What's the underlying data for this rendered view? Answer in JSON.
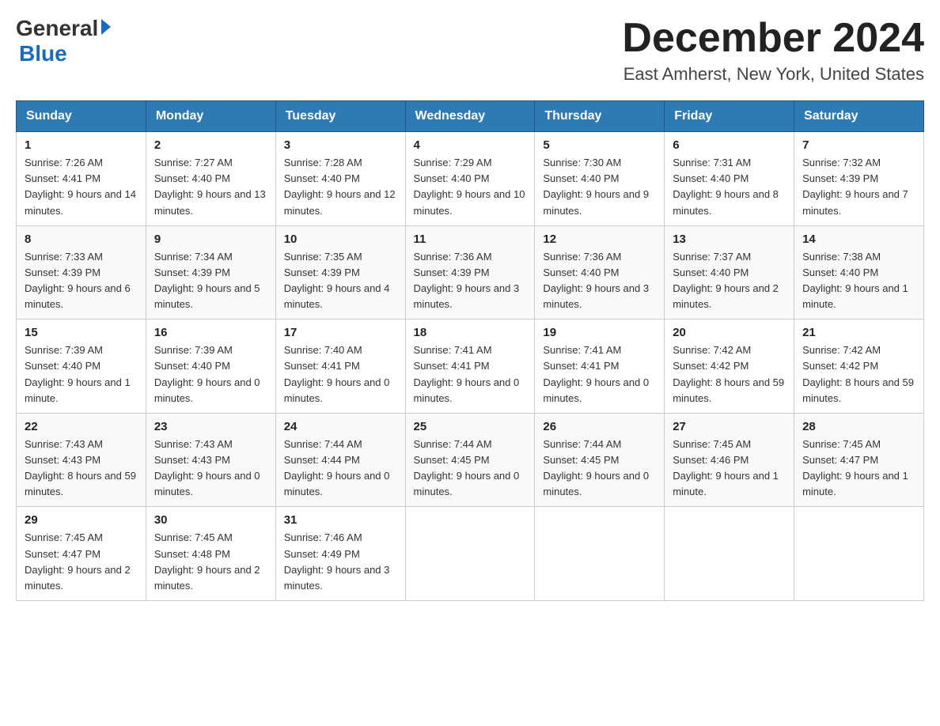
{
  "header": {
    "logo_general": "General",
    "logo_blue": "Blue",
    "month_title": "December 2024",
    "location": "East Amherst, New York, United States"
  },
  "days_of_week": [
    "Sunday",
    "Monday",
    "Tuesday",
    "Wednesday",
    "Thursday",
    "Friday",
    "Saturday"
  ],
  "weeks": [
    [
      {
        "day": "1",
        "sunrise": "7:26 AM",
        "sunset": "4:41 PM",
        "daylight": "9 hours and 14 minutes."
      },
      {
        "day": "2",
        "sunrise": "7:27 AM",
        "sunset": "4:40 PM",
        "daylight": "9 hours and 13 minutes."
      },
      {
        "day": "3",
        "sunrise": "7:28 AM",
        "sunset": "4:40 PM",
        "daylight": "9 hours and 12 minutes."
      },
      {
        "day": "4",
        "sunrise": "7:29 AM",
        "sunset": "4:40 PM",
        "daylight": "9 hours and 10 minutes."
      },
      {
        "day": "5",
        "sunrise": "7:30 AM",
        "sunset": "4:40 PM",
        "daylight": "9 hours and 9 minutes."
      },
      {
        "day": "6",
        "sunrise": "7:31 AM",
        "sunset": "4:40 PM",
        "daylight": "9 hours and 8 minutes."
      },
      {
        "day": "7",
        "sunrise": "7:32 AM",
        "sunset": "4:39 PM",
        "daylight": "9 hours and 7 minutes."
      }
    ],
    [
      {
        "day": "8",
        "sunrise": "7:33 AM",
        "sunset": "4:39 PM",
        "daylight": "9 hours and 6 minutes."
      },
      {
        "day": "9",
        "sunrise": "7:34 AM",
        "sunset": "4:39 PM",
        "daylight": "9 hours and 5 minutes."
      },
      {
        "day": "10",
        "sunrise": "7:35 AM",
        "sunset": "4:39 PM",
        "daylight": "9 hours and 4 minutes."
      },
      {
        "day": "11",
        "sunrise": "7:36 AM",
        "sunset": "4:39 PM",
        "daylight": "9 hours and 3 minutes."
      },
      {
        "day": "12",
        "sunrise": "7:36 AM",
        "sunset": "4:40 PM",
        "daylight": "9 hours and 3 minutes."
      },
      {
        "day": "13",
        "sunrise": "7:37 AM",
        "sunset": "4:40 PM",
        "daylight": "9 hours and 2 minutes."
      },
      {
        "day": "14",
        "sunrise": "7:38 AM",
        "sunset": "4:40 PM",
        "daylight": "9 hours and 1 minute."
      }
    ],
    [
      {
        "day": "15",
        "sunrise": "7:39 AM",
        "sunset": "4:40 PM",
        "daylight": "9 hours and 1 minute."
      },
      {
        "day": "16",
        "sunrise": "7:39 AM",
        "sunset": "4:40 PM",
        "daylight": "9 hours and 0 minutes."
      },
      {
        "day": "17",
        "sunrise": "7:40 AM",
        "sunset": "4:41 PM",
        "daylight": "9 hours and 0 minutes."
      },
      {
        "day": "18",
        "sunrise": "7:41 AM",
        "sunset": "4:41 PM",
        "daylight": "9 hours and 0 minutes."
      },
      {
        "day": "19",
        "sunrise": "7:41 AM",
        "sunset": "4:41 PM",
        "daylight": "9 hours and 0 minutes."
      },
      {
        "day": "20",
        "sunrise": "7:42 AM",
        "sunset": "4:42 PM",
        "daylight": "8 hours and 59 minutes."
      },
      {
        "day": "21",
        "sunrise": "7:42 AM",
        "sunset": "4:42 PM",
        "daylight": "8 hours and 59 minutes."
      }
    ],
    [
      {
        "day": "22",
        "sunrise": "7:43 AM",
        "sunset": "4:43 PM",
        "daylight": "8 hours and 59 minutes."
      },
      {
        "day": "23",
        "sunrise": "7:43 AM",
        "sunset": "4:43 PM",
        "daylight": "9 hours and 0 minutes."
      },
      {
        "day": "24",
        "sunrise": "7:44 AM",
        "sunset": "4:44 PM",
        "daylight": "9 hours and 0 minutes."
      },
      {
        "day": "25",
        "sunrise": "7:44 AM",
        "sunset": "4:45 PM",
        "daylight": "9 hours and 0 minutes."
      },
      {
        "day": "26",
        "sunrise": "7:44 AM",
        "sunset": "4:45 PM",
        "daylight": "9 hours and 0 minutes."
      },
      {
        "day": "27",
        "sunrise": "7:45 AM",
        "sunset": "4:46 PM",
        "daylight": "9 hours and 1 minute."
      },
      {
        "day": "28",
        "sunrise": "7:45 AM",
        "sunset": "4:47 PM",
        "daylight": "9 hours and 1 minute."
      }
    ],
    [
      {
        "day": "29",
        "sunrise": "7:45 AM",
        "sunset": "4:47 PM",
        "daylight": "9 hours and 2 minutes."
      },
      {
        "day": "30",
        "sunrise": "7:45 AM",
        "sunset": "4:48 PM",
        "daylight": "9 hours and 2 minutes."
      },
      {
        "day": "31",
        "sunrise": "7:46 AM",
        "sunset": "4:49 PM",
        "daylight": "9 hours and 3 minutes."
      },
      null,
      null,
      null,
      null
    ]
  ]
}
